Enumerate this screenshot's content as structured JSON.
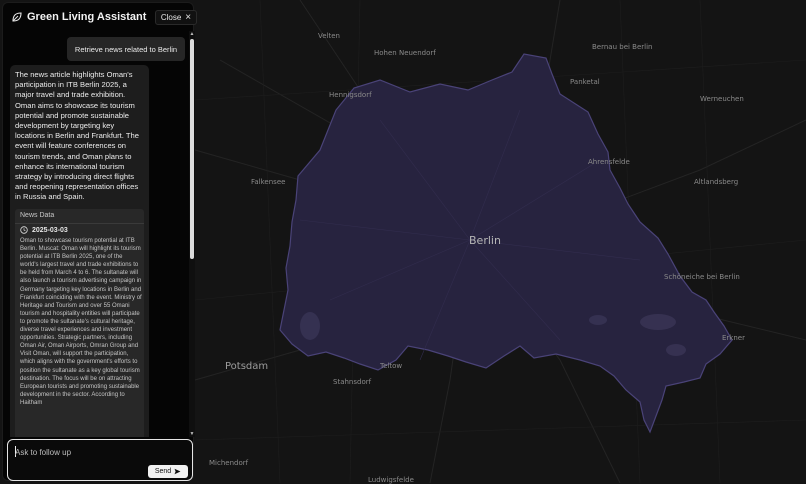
{
  "assistant": {
    "title": "Green Living Assistant",
    "close_label": "Close"
  },
  "chat": {
    "user_message": "Retrieve news related to Berlin",
    "assistant_reply": "The news article highlights Oman's participation in ITB Berlin 2025, a major travel and trade exhibition. Oman aims to showcase its tourism potential and promote sustainable development by targeting key locations in Berlin and Frankfurt. The event will feature conferences on tourism trends, and Oman plans to enhance its international tourism strategy by introducing direct flights and reopening representation offices in Russia and Spain.",
    "news": {
      "label": "News Data",
      "date": "2025-03-03",
      "body": "Oman to showcase tourism potential at ITB Berlin. Muscat: Oman will highlight its tourism potential at ITB Berlin 2025, one of the world's largest travel and trade exhibitions to be held from March 4 to 6. The sultanate will also launch a tourism advertising campaign in Germany targeting key locations in Berlin and Frankfurt coinciding with the event. Ministry of Heritage and Tourism and over 55 Omani tourism and hospitality entities will participate to promote the sultanate's cultural heritage, diverse travel experiences and investment opportunities. Strategic partners, including Oman Air, Oman Airports, Omran Group and Visit Oman, will support the participation, which aligns with the government's efforts to position the sultanate as a key global tourism destination. The focus will be on attracting European tourists and promoting sustainable development in the sector. According to Haitham"
    }
  },
  "composer": {
    "placeholder": "Ask to follow up",
    "send_label": "Send"
  },
  "map": {
    "city_label": "Berlin",
    "places": {
      "velten": "Velten",
      "hohen_neuendorf": "Hohen Neuendorf",
      "bernau": "Bernau bei Berlin",
      "panketal": "Panketal",
      "hennigsdorf": "Hennigsdorf",
      "werneuchen": "Werneuchen",
      "ahrensfelde": "Ahrensfelde",
      "falkensee": "Falkensee",
      "altlandsberg": "Altlandsberg",
      "schoneiche": "Schöneiche bei Berlin",
      "erkner": "Erkner",
      "potsdam": "Potsdam",
      "teltow": "Teltow",
      "stahnsdorf": "Stahnsdorf",
      "michendorf": "Michendorf",
      "ludwigsfelde": "Ludwigsfelde"
    },
    "colors": {
      "background": "#141414",
      "region_fill": "#27233f",
      "region_stroke": "#4a4378",
      "water": "#3a3556"
    }
  }
}
